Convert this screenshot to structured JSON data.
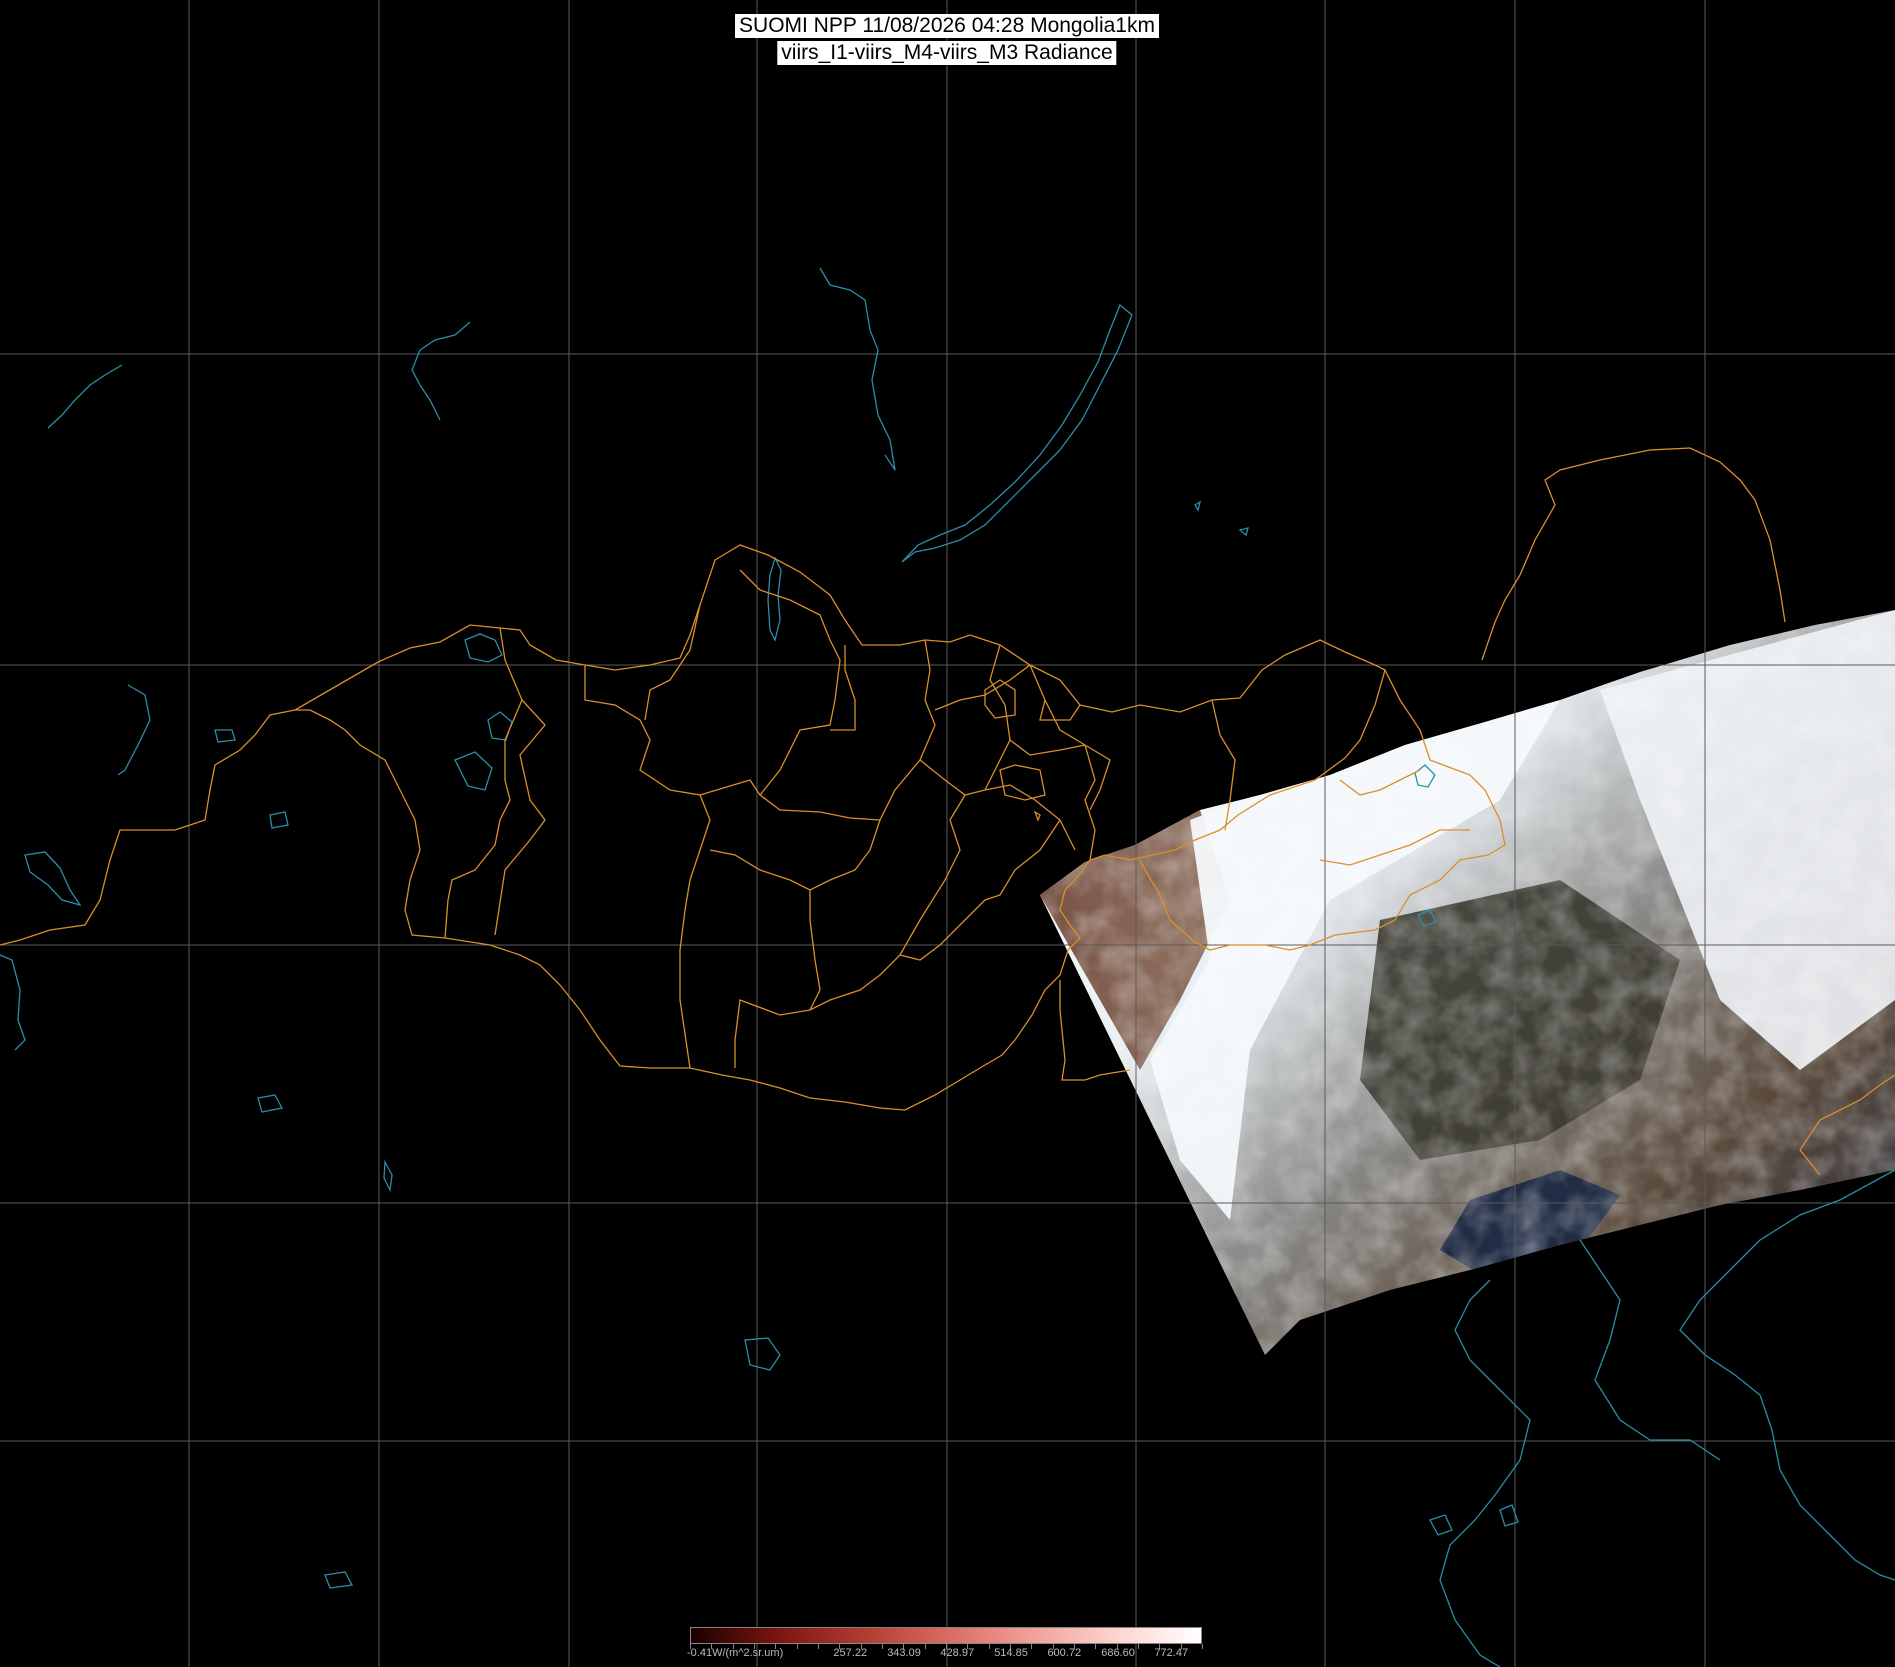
{
  "header": {
    "title_line1": "SUOMI NPP 11/08/2026 04:28 Mongolia1km",
    "title_line2": "viirs_I1-viirs_M4-viirs_M3 Radiance"
  },
  "colorbar": {
    "labels": [
      "-0.41W/(m^2.sr.um)",
      "257.22",
      "343.09",
      "428.97",
      "514.85",
      "600.72",
      "686.60",
      "772.47"
    ],
    "colors": [
      "#1a0000",
      "#7a1410",
      "#b03a30",
      "#d86a60",
      "#f0a098",
      "#fcd4d0",
      "#ffffff"
    ]
  },
  "map_layers": {
    "graticule_color": "#5a5a5a",
    "coastline_color": "#2a8fa8",
    "province_border_color": "#d8902a",
    "background": "#000000"
  }
}
